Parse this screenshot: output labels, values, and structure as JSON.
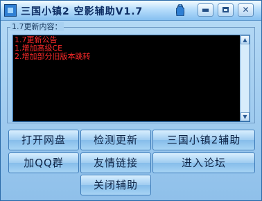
{
  "window": {
    "title": "三国小镇2 空影辅助V1.7"
  },
  "titlebar_buttons": {
    "minimize": "▬",
    "maximize": "",
    "close": "✕"
  },
  "group": {
    "label": "1.7更新内容：",
    "lines": [
      "1.7更新公告",
      "1.增加高级CE",
      "2.增加部分旧版本跳转"
    ]
  },
  "scrollbar": {
    "up": "▲",
    "down": "▼"
  },
  "buttons": {
    "open_netdisk": "打开网盘",
    "check_update": "检测更新",
    "sanguo_helper": "三国小镇2辅助",
    "join_qq": "加QQ群",
    "friend_links": "友情链接",
    "enter_forum": "进入论坛",
    "close_helper": "关闭辅助"
  },
  "colors": {
    "text_red": "#ff2a2a",
    "textbox_bg": "#000000",
    "accent_blue": "#3d7bb9"
  }
}
